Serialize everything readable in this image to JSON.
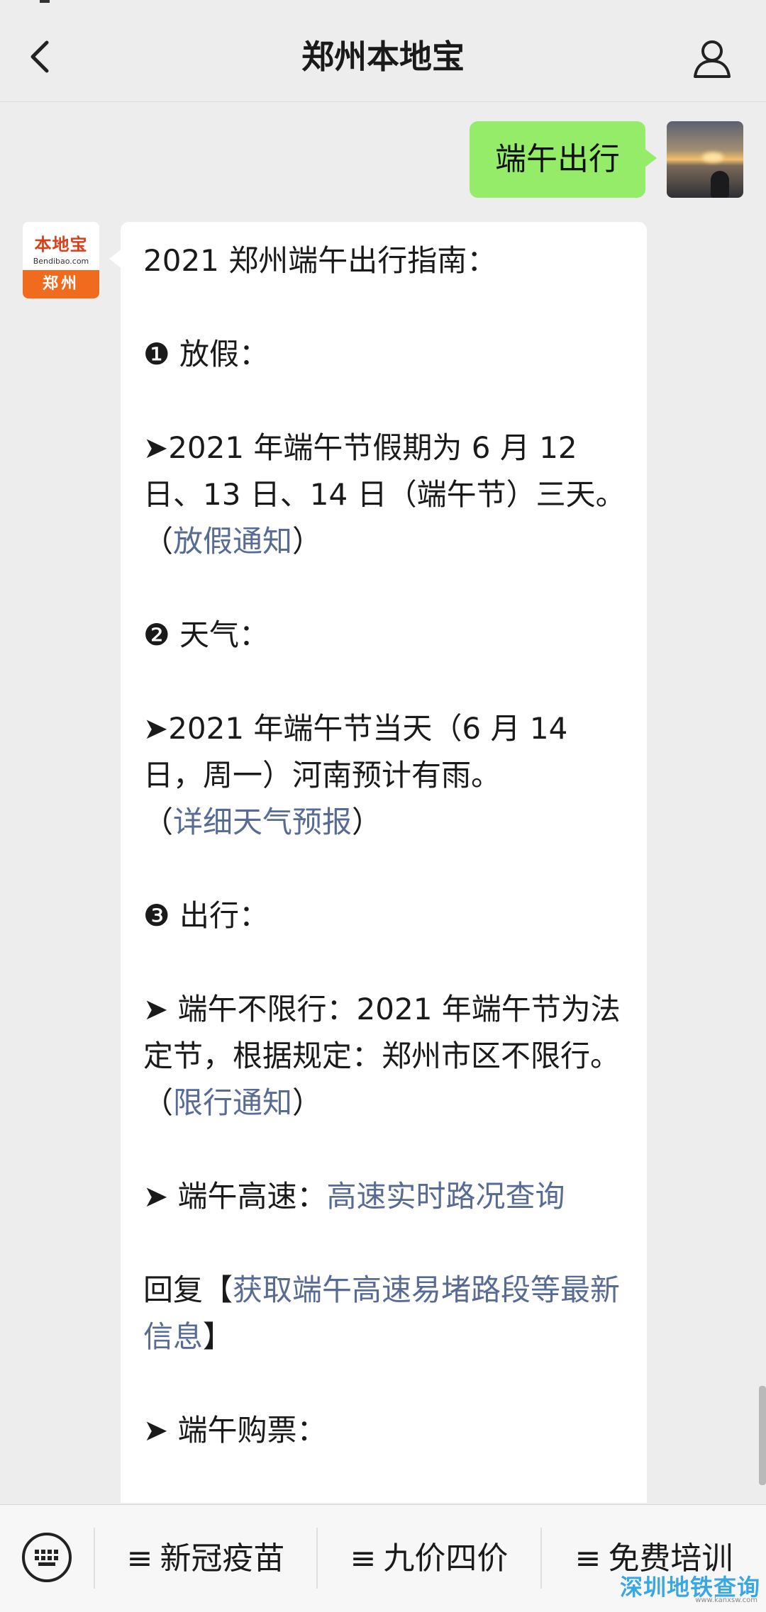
{
  "navbar": {
    "title": "郑州本地宝"
  },
  "messages": {
    "user_text": "端午出行",
    "bot_avatar": {
      "logo_text": "本地宝",
      "site_text": "Bendibao.com",
      "city_text": "郑州"
    },
    "bot_lines": {
      "l1": "2021 郑州端午出行指南：",
      "l2": "❶ 放假：",
      "l3": "➤2021 年端午节假期为 6 月 12 日、13 日、14 日（端午节）三天。",
      "l4_open": "（",
      "l4_link": "放假通知",
      "l4_close": "）",
      "l5": "❷ 天气：",
      "l6": "➤2021 年端午节当天（6 月 14 日，周一）河南预计有雨。",
      "l7_open": "（",
      "l7_link": "详细天气预报",
      "l7_close": "）",
      "l8": "❸ 出行：",
      "l9": "➤ 端午不限行：2021 年端午节为法定节，根据规定：郑州市区不限行。（",
      "l9_link": "限行通知",
      "l9_close": "）",
      "l10": "➤ 端午高速：",
      "l10_link": "高速实时路况查询",
      "l11": "回复【",
      "l11_link": "获取端午高速易堵路段等最新信息",
      "l11_close": "】",
      "l12": "➤ 端午购票："
    }
  },
  "bottom_menu": {
    "items": [
      {
        "eq": "≡",
        "label": "新冠疫苗"
      },
      {
        "eq": "≡",
        "label": "九价四价"
      },
      {
        "eq": "≡",
        "label": "免费培训"
      }
    ]
  },
  "watermark": {
    "text": "深圳地铁查询",
    "url": "www.kanxsw.com"
  },
  "colors": {
    "link": "#576b95",
    "user_bubble": "#95ec69",
    "background": "#ededed"
  },
  "icons": [
    "back-arrow-icon",
    "profile-icon",
    "keyboard-icon"
  ]
}
